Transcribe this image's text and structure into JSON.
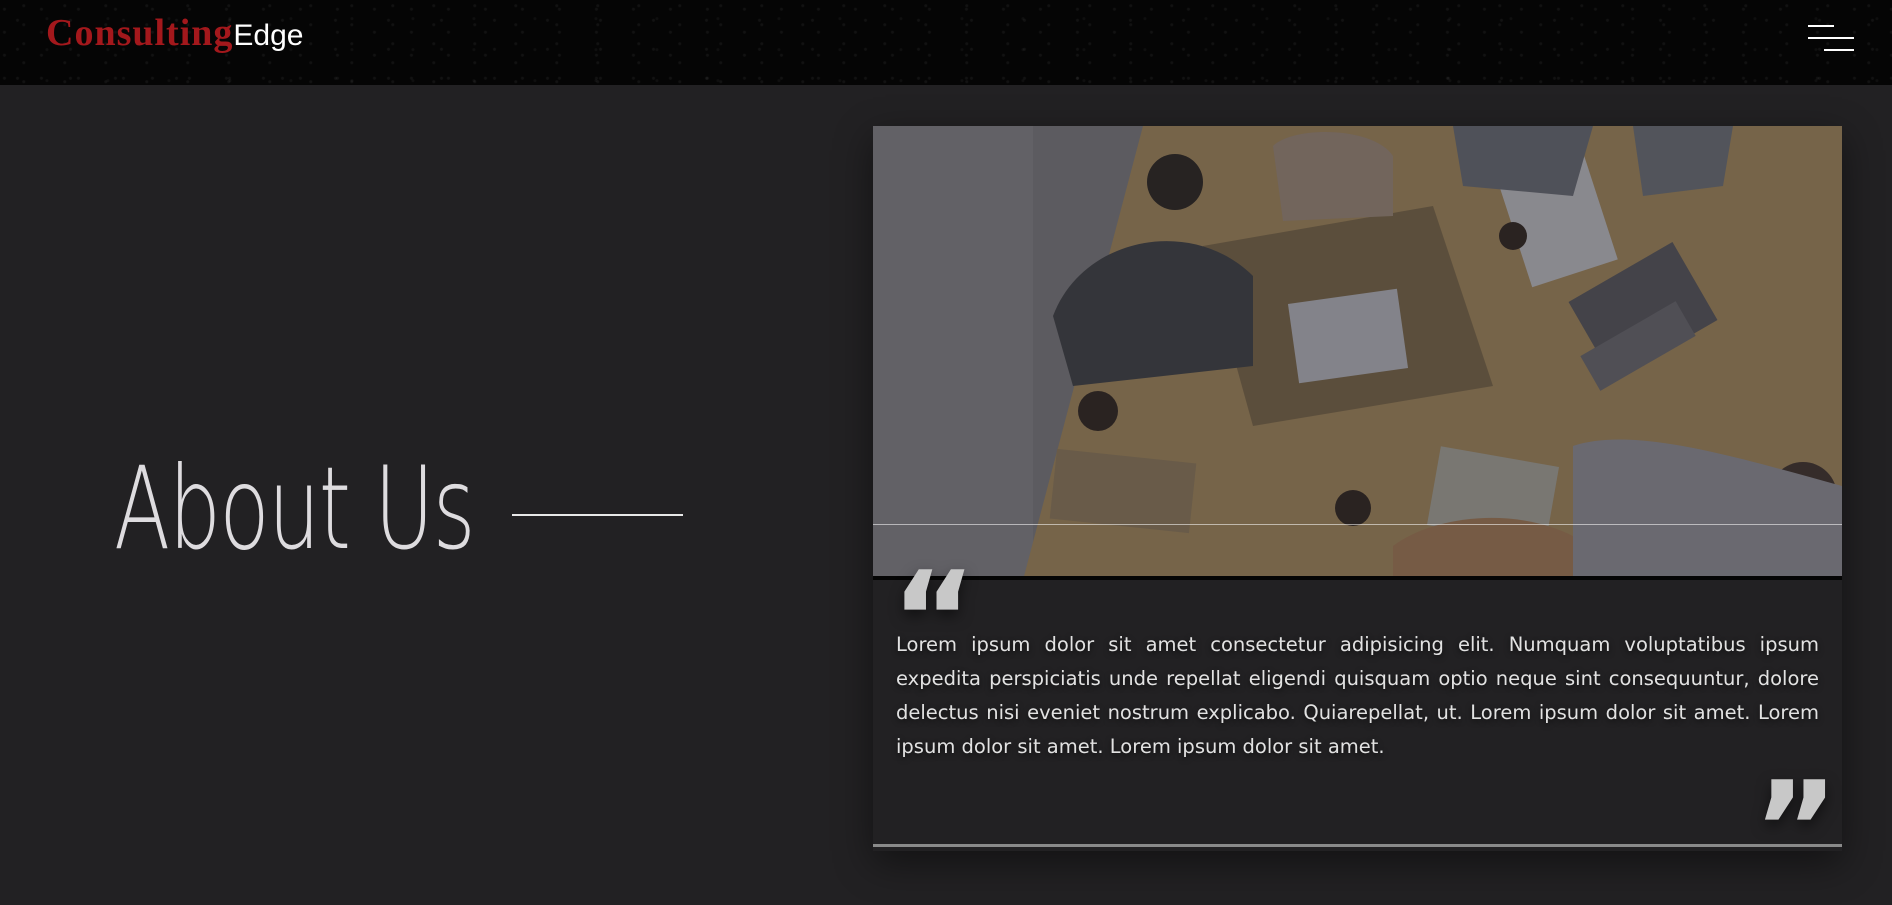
{
  "header": {
    "logo_primary": "Consulting",
    "logo_secondary": "Edge",
    "menu_icon": "hamburger-menu-icon"
  },
  "about": {
    "title": "About Us"
  },
  "testimonial": {
    "quote_open": "“",
    "quote_close": "”",
    "text": "Lorem ipsum dolor sit amet consectetur adipisicing elit. Numquam voluptatibus ipsum expedita perspiciatis unde repellat eligendi quisquam optio neque sint consequuntur, dolore delectus nisi eveniet nostrum explicabo. Quiarepellat, ut. Lorem ipsum dolor sit amet. Lorem ipsum dolor sit amet. Lorem ipsum dolor sit amet."
  },
  "colors": {
    "page_background": "#222123",
    "header_background": "#050505",
    "brand_red": "#a3181c",
    "text_light": "#e2e2e2"
  }
}
